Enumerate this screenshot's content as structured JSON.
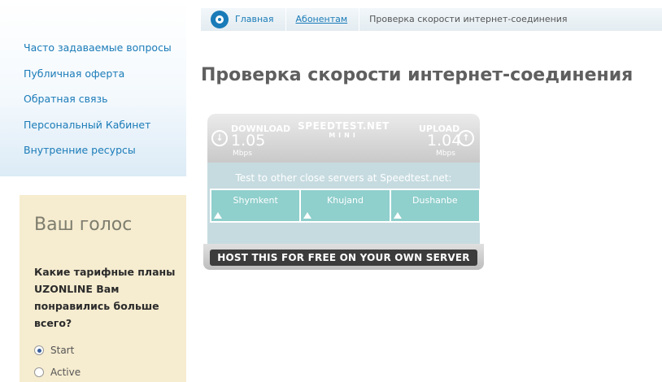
{
  "sidebar": {
    "items": [
      "Часто задаваемые вопросы",
      "Публичная оферта",
      "Обратная связь",
      "Персональный Кабинет",
      "Внутренние ресурсы"
    ]
  },
  "vote": {
    "title": "Ваш голос",
    "question": "Какие тарифные планы UZONLINE Вам понравились больше всего?",
    "options": [
      {
        "label": "Start",
        "selected": true
      },
      {
        "label": "Active",
        "selected": false
      }
    ]
  },
  "breadcrumb": {
    "home": "Главная",
    "section": "Абонентам",
    "current": "Проверка скорости интернет-соединения"
  },
  "page": {
    "title": "Проверка скорости интернет-соединения"
  },
  "speedtest": {
    "logo": "SPEEDTEST.NET",
    "logo_sub": "MINI",
    "download_label": "DOWNLOAD",
    "download_value": "1.05",
    "download_unit": "Mbps",
    "upload_label": "UPLOAD",
    "upload_value": "1.04",
    "upload_unit": "Mbps",
    "message": "Test to other close servers at Speedtest.net:",
    "servers": [
      "Shymkent",
      "Khujand",
      "Dushanbe"
    ],
    "host_banner": "HOST THIS FOR FREE ON YOUR OWN SERVER"
  },
  "colors": {
    "link": "#1a7bb8",
    "vote_bg": "#f6ecd0",
    "speedtest_panel": "#8fcfcc"
  }
}
